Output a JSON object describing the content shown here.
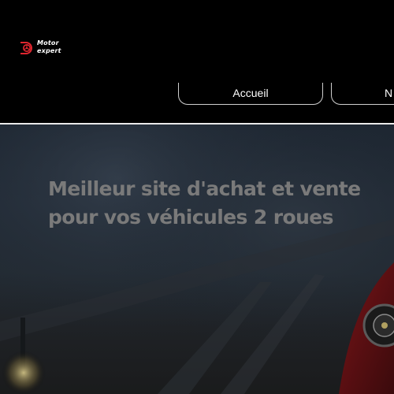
{
  "logo": {
    "line1": "Motor",
    "line2": "expert",
    "icon": "turbo-logo-icon",
    "accent_color": "#e0262f"
  },
  "nav": {
    "items": [
      {
        "label": "Accueil"
      },
      {
        "label": "N"
      }
    ]
  },
  "hero": {
    "title_line1": "Meilleur site d'achat et vente",
    "title_line2": "pour vos véhicules 2 roues"
  }
}
